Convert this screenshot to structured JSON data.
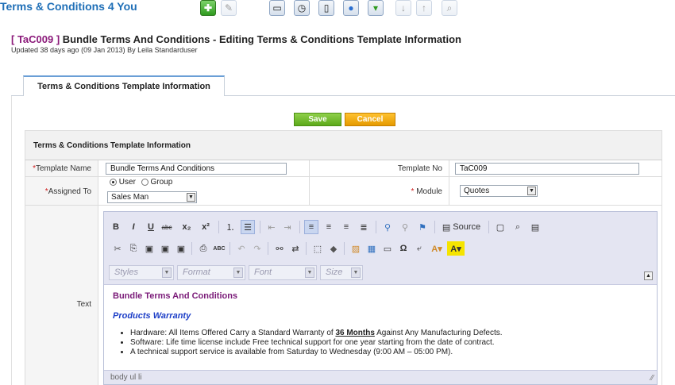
{
  "app": {
    "title": "Terms & Conditions 4 You"
  },
  "toolbar_icons": [
    "add-icon",
    "edit-icon",
    "calendar-icon",
    "clock-icon",
    "mobile-icon",
    "chat-icon",
    "download-icon",
    "arrow-down-icon",
    "arrow-up-icon",
    "preview-icon"
  ],
  "record": {
    "id": "[ TaC009 ]",
    "title": "Bundle Terms And Conditions - Editing Terms & Conditions Template Information",
    "updated": "Updated 38 days ago (09 Jan 2013) By Leila Standarduser"
  },
  "tabs": [
    {
      "label": "Terms & Conditions Template Information"
    }
  ],
  "actions": {
    "save": "Save",
    "cancel": "Cancel"
  },
  "section": {
    "title": "Terms & Conditions Template Information"
  },
  "fields": {
    "template_name": {
      "label": "Template Name",
      "value": "Bundle Terms And Conditions"
    },
    "template_no": {
      "label": "Template No",
      "value": "TaC009"
    },
    "assigned_to": {
      "label": "Assigned To",
      "radio_user": "User",
      "radio_group": "Group",
      "selected": "Sales Man"
    },
    "module": {
      "label": "Module",
      "selected": "Quotes"
    },
    "text": {
      "label": "Text"
    }
  },
  "required_mark": "*",
  "editor": {
    "toolbar_row1": [
      "B",
      "I",
      "U",
      "abc",
      "x₂",
      "x²",
      "≡",
      "☰",
      "⇤",
      "⇥",
      "⬅",
      "≡",
      "⮕",
      "☰",
      "👥",
      "👤",
      "⚑",
      "Source",
      "☐",
      "🔍",
      "📄"
    ],
    "toolbar_row2": [
      "✂",
      "📋",
      "📋",
      "📋",
      "📋",
      "🖶",
      "ABC",
      "↶",
      "↷",
      "🔍",
      "⇄",
      "⬚",
      "◇",
      "🖼",
      "▦",
      "▭",
      "Ω",
      "↵",
      "A",
      "A"
    ],
    "combos": {
      "styles": "Styles",
      "format": "Format",
      "font": "Font",
      "size": "Size"
    },
    "source_label": "Source",
    "content": {
      "heading": "Bundle Terms And Conditions",
      "subheading": "Products Warranty",
      "item1_pre": "Hardware: All Items Offered Carry a Standard Warranty of ",
      "item1_bold": "36 Months",
      "item1_post": " Against Any Manufacturing Defects.",
      "item2": "Software: Life time license include Free technical support for one year starting from the date of contract.",
      "item3": "A technical support service is available from Saturday to Wednesday (9:00 AM – 05:00 PM)."
    },
    "status_path": "body  ul  li"
  }
}
